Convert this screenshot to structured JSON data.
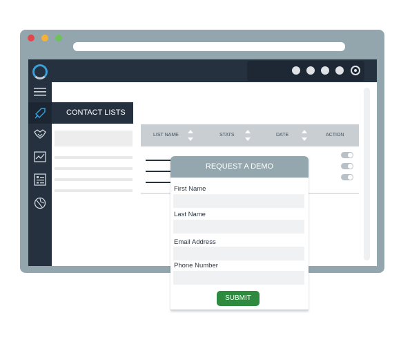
{
  "window": {
    "controls": [
      "close",
      "minimize",
      "maximize"
    ],
    "control_colors": [
      "#e2484b",
      "#f5b135",
      "#6fc15a"
    ],
    "url": ""
  },
  "topbar": {
    "icons": [
      "status-dot",
      "status-dot",
      "status-dot",
      "status-dot",
      "settings-ring-icon"
    ]
  },
  "sidebar": {
    "items": [
      {
        "icon": "hamburger-menu-icon"
      },
      {
        "icon": "rocket-icon",
        "active": true
      },
      {
        "icon": "handshake-icon"
      },
      {
        "icon": "chart-icon"
      },
      {
        "icon": "form-icon"
      },
      {
        "icon": "globe-icon"
      }
    ],
    "accent": "#3aa0d8"
  },
  "main": {
    "tab_label": "CONTACT LISTS",
    "table": {
      "columns": [
        "LIST NAME",
        "STATS",
        "DATE",
        "ACTION"
      ]
    }
  },
  "modal": {
    "title": "REQUEST A DEMO",
    "fields": [
      {
        "label": "First Name",
        "value": ""
      },
      {
        "label": "Last Name",
        "value": ""
      },
      {
        "label": "Email Address",
        "value": ""
      },
      {
        "label": "Phone Number",
        "value": ""
      }
    ],
    "submit_label": "SUBMIT",
    "submit_color": "#2e8a3e"
  }
}
